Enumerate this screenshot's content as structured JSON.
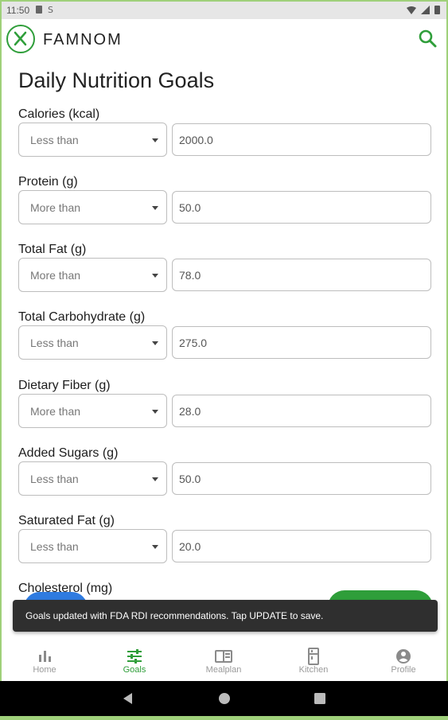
{
  "status_bar": {
    "time": "11:50"
  },
  "app_bar": {
    "brand": "FAMNOM",
    "icons": [
      "logo-icon",
      "search-icon"
    ]
  },
  "page": {
    "title": "Daily Nutrition Goals"
  },
  "goals": [
    {
      "label": "Calories (kcal)",
      "comparison": "Less than",
      "value": "2000.0"
    },
    {
      "label": "Protein (g)",
      "comparison": "More than",
      "value": "50.0"
    },
    {
      "label": "Total Fat (g)",
      "comparison": "More than",
      "value": "78.0"
    },
    {
      "label": "Total Carbohydrate (g)",
      "comparison": "Less than",
      "value": "275.0"
    },
    {
      "label": "Dietary Fiber (g)",
      "comparison": "More than",
      "value": "28.0"
    },
    {
      "label": "Added Sugars (g)",
      "comparison": "Less than",
      "value": "50.0"
    },
    {
      "label": "Saturated Fat (g)",
      "comparison": "Less than",
      "value": "20.0"
    },
    {
      "label": "Cholesterol (mg)"
    }
  ],
  "snackbar": {
    "message": "Goals updated with FDA RDI recommendations. Tap UPDATE to save."
  },
  "bottom_nav": {
    "items": [
      {
        "label": "Home",
        "icon": "bar-chart-icon"
      },
      {
        "label": "Goals",
        "icon": "tune-icon",
        "active": true
      },
      {
        "label": "Mealplan",
        "icon": "book-icon"
      },
      {
        "label": "Kitchen",
        "icon": "fridge-icon"
      },
      {
        "label": "Profile",
        "icon": "person-icon"
      }
    ]
  },
  "colors": {
    "accent": "#2f9e3a",
    "snackbar_bg": "#2f2f2f",
    "frame": "#9fd07a"
  }
}
